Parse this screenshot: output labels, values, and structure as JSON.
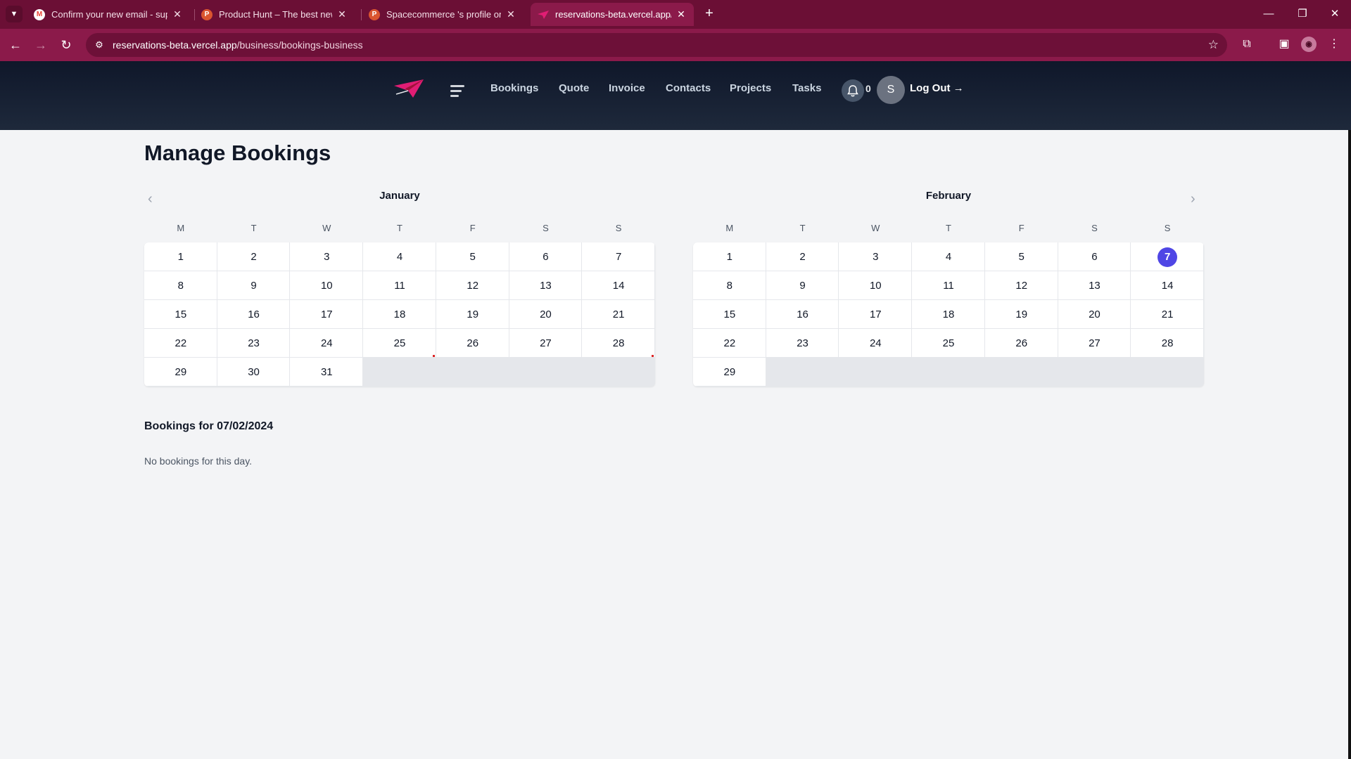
{
  "browser": {
    "tabs": [
      {
        "title": "Confirm your new email - supp",
        "icon": "gmail-icon",
        "active": false
      },
      {
        "title": "Product Hunt – The best new p",
        "icon": "product-hunt-icon",
        "active": false
      },
      {
        "title": "Spacecommerce 's profile on Pr",
        "icon": "product-hunt-icon",
        "active": false
      },
      {
        "title": "reservations-beta.vercel.app/bu",
        "icon": "paper-plane-icon",
        "active": true
      }
    ],
    "url_host": "reservations-beta.vercel.app",
    "url_path": "/business/bookings-business",
    "theme_color": "#8b1a4a"
  },
  "nav": {
    "links": [
      "Bookings",
      "Quote",
      "Invoice",
      "Contacts",
      "Projects",
      "Tasks"
    ],
    "notification_count": "0",
    "avatar_initial": "S",
    "logout_label": "Log Out →"
  },
  "page": {
    "title": "Manage Bookings",
    "bookings_heading": "Bookings for 07/02/2024",
    "empty_message": "No bookings for this day."
  },
  "calendar": {
    "weekday_labels": [
      "M",
      "T",
      "W",
      "T",
      "F",
      "S",
      "S"
    ],
    "selected_color": "#4f46e5",
    "months": [
      {
        "name": "January",
        "days": 31,
        "selected_day": null,
        "marked_days": [
          25,
          28
        ]
      },
      {
        "name": "February",
        "days": 29,
        "selected_day": 7,
        "marked_days": []
      }
    ]
  }
}
